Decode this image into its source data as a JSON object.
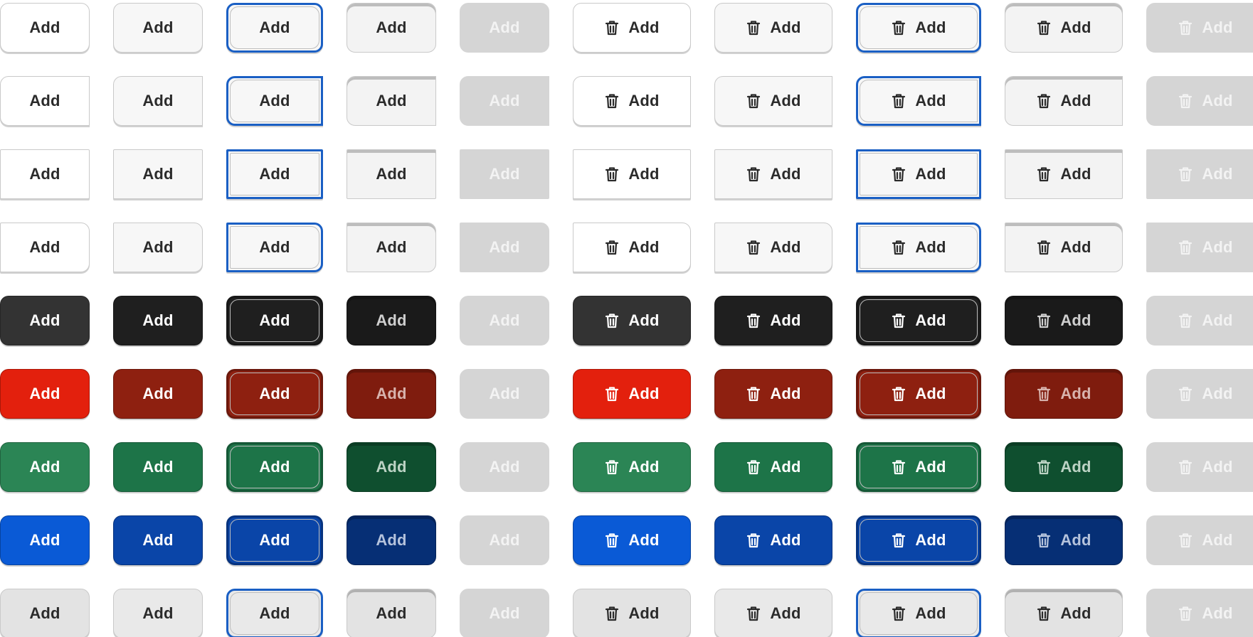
{
  "label": "Add",
  "icon": "trash-icon",
  "columns": [
    {
      "state": "default",
      "icon": false
    },
    {
      "state": "hover",
      "icon": false
    },
    {
      "state": "focus",
      "icon": false
    },
    {
      "state": "pressed",
      "icon": false
    },
    {
      "state": "disabled",
      "icon": false
    },
    {
      "state": "default",
      "icon": true
    },
    {
      "state": "hover",
      "icon": true
    },
    {
      "state": "focus",
      "icon": true
    },
    {
      "state": "pressed",
      "icon": true
    },
    {
      "state": "disabled",
      "icon": true
    }
  ],
  "rows": [
    {
      "variant": "light",
      "shape": "rounded",
      "colors": {
        "default": "#ffffff",
        "hover": "#f7f7f7",
        "focus": "#f7f7f7",
        "pressed": "#f3f3f3",
        "text": "#2b2b2b",
        "pressed_text": "#2b2b2b"
      }
    },
    {
      "variant": "light",
      "shape": "left",
      "colors": {
        "default": "#ffffff",
        "hover": "#f7f7f7",
        "focus": "#f7f7f7",
        "pressed": "#f3f3f3",
        "text": "#2b2b2b",
        "pressed_text": "#2b2b2b"
      }
    },
    {
      "variant": "light",
      "shape": "square",
      "colors": {
        "default": "#ffffff",
        "hover": "#f7f7f7",
        "focus": "#f7f7f7",
        "pressed": "#f3f3f3",
        "text": "#2b2b2b",
        "pressed_text": "#2b2b2b"
      }
    },
    {
      "variant": "light",
      "shape": "right",
      "colors": {
        "default": "#ffffff",
        "hover": "#f7f7f7",
        "focus": "#f7f7f7",
        "pressed": "#f3f3f3",
        "text": "#2b2b2b",
        "pressed_text": "#2b2b2b"
      }
    },
    {
      "variant": "dark",
      "shape": "rounded",
      "colors": {
        "default": "#333333",
        "hover": "#1f1f1f",
        "focus": "#1f1f1f",
        "pressed": "#1a1a1a",
        "text": "#ffffff",
        "pressed_text": "#cfcfcf"
      }
    },
    {
      "variant": "red",
      "shape": "rounded",
      "colors": {
        "default": "#e3200d",
        "hover": "#8e2010",
        "focus": "#8e2010",
        "pressed": "#7f1c0e",
        "text": "#ffffff",
        "pressed_text": "#d8b3ad"
      }
    },
    {
      "variant": "green",
      "shape": "rounded",
      "colors": {
        "default": "#2b8555",
        "hover": "#1d7448",
        "focus": "#1d7448",
        "pressed": "#0f4f2f",
        "text": "#ffffff",
        "pressed_text": "#bcd3c4"
      }
    },
    {
      "variant": "blue",
      "shape": "rounded",
      "colors": {
        "default": "#0a5ad6",
        "hover": "#0a45a8",
        "focus": "#0a45a8",
        "pressed": "#062f75",
        "text": "#ffffff",
        "pressed_text": "#b5c3dc"
      }
    },
    {
      "variant": "gray",
      "shape": "rounded",
      "colors": {
        "default": "#e3e3e3",
        "hover": "#e9e9e9",
        "focus": "#e9e9e9",
        "pressed": "#e3e3e3",
        "text": "#2b2b2b",
        "pressed_text": "#2b2b2b"
      }
    }
  ]
}
